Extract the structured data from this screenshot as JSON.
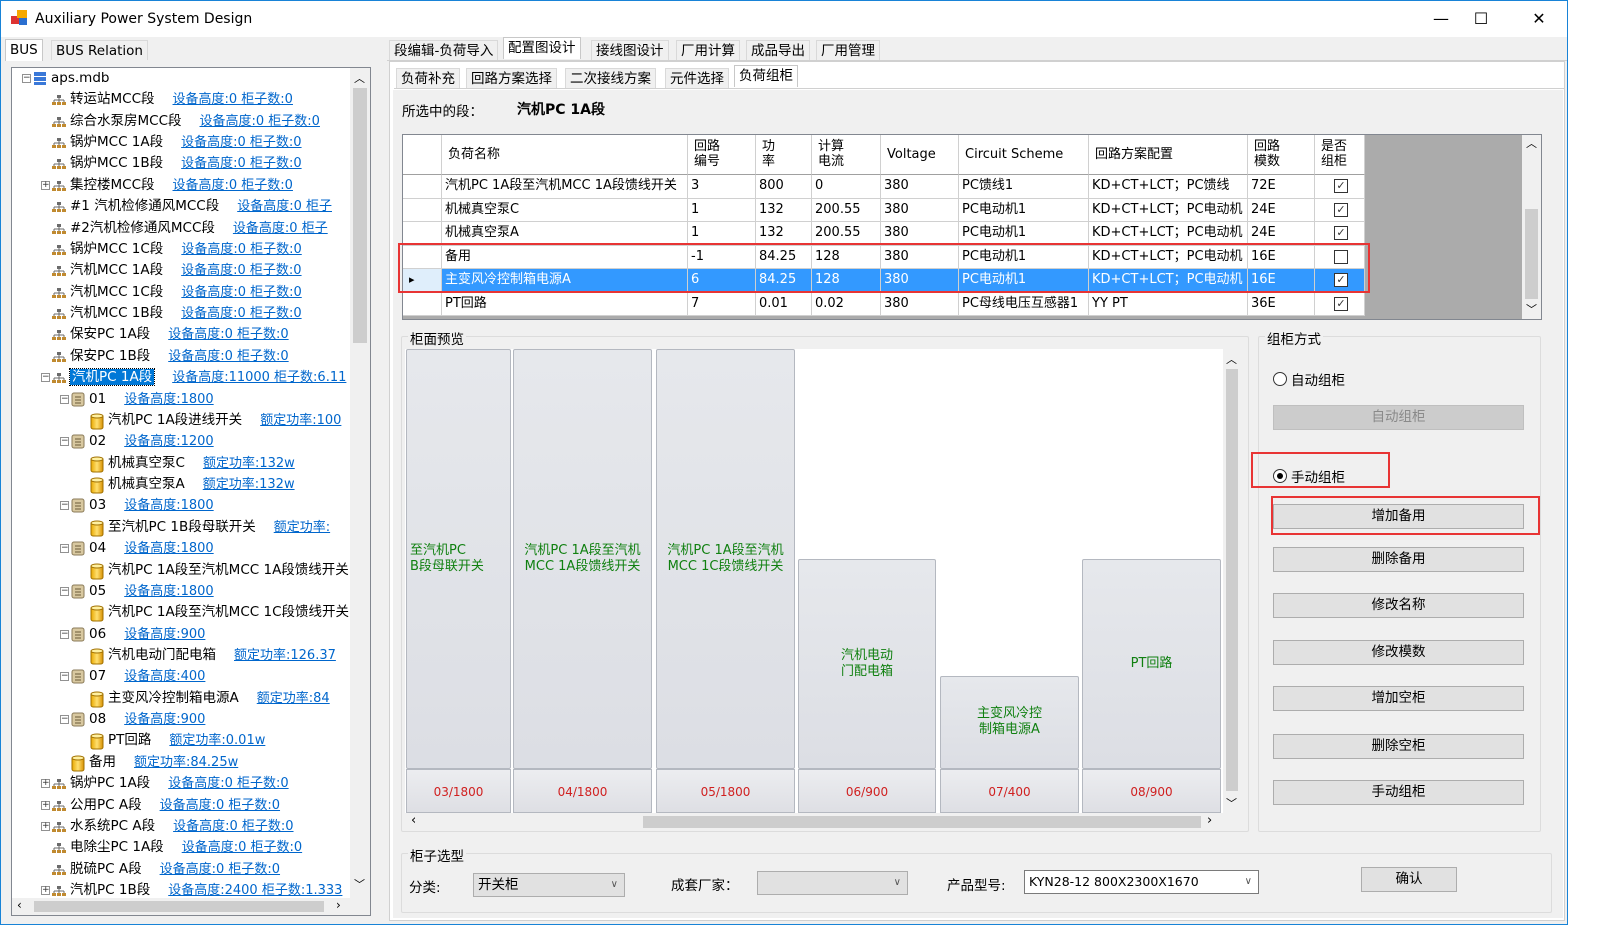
{
  "window": {
    "title": "Auxiliary Power System Design",
    "controls": [
      "—",
      "☐",
      "✕"
    ]
  },
  "left_tabs": [
    "BUS",
    "BUS Relation"
  ],
  "main_tabs": [
    "段编辑-负荷导入",
    "配置图设计",
    "接线图设计",
    "厂用计算",
    "成品导出",
    "厂用管理"
  ],
  "sub_tabs": [
    "负荷补充",
    "回路方案选择",
    "二次接线方案",
    "元件选择",
    "负荷组柜"
  ],
  "selected_segment": {
    "label": "所选中的段：",
    "value": "汽机PC 1A段"
  },
  "tree": [
    {
      "level": 0,
      "icon": "database-icon",
      "exp": "-",
      "label": "aps.mdb",
      "link": ""
    },
    {
      "level": 1,
      "icon": "network-icon",
      "exp": "",
      "label": "转运站MCC段",
      "link": "设备高度:0  柜子数:0"
    },
    {
      "level": 1,
      "icon": "network-icon",
      "exp": "",
      "label": "综合水泵房MCC段",
      "link": "设备高度:0  柜子数:0"
    },
    {
      "level": 1,
      "icon": "network-icon",
      "exp": "",
      "label": "锅炉MCC 1A段",
      "link": "设备高度:0  柜子数:0"
    },
    {
      "level": 1,
      "icon": "network-icon",
      "exp": "",
      "label": "锅炉MCC 1B段",
      "link": "设备高度:0  柜子数:0"
    },
    {
      "level": 1,
      "icon": "network-icon",
      "exp": "+",
      "label": "集控楼MCC段",
      "link": "设备高度:0  柜子数:0"
    },
    {
      "level": 1,
      "icon": "network-icon",
      "exp": "",
      "label": "#1 汽机检修通风MCC段",
      "link": "设备高度:0  柜子"
    },
    {
      "level": 1,
      "icon": "network-icon",
      "exp": "",
      "label": "#2汽机检修通风MCC段",
      "link": "设备高度:0  柜子"
    },
    {
      "level": 1,
      "icon": "network-icon",
      "exp": "",
      "label": "锅炉MCC 1C段",
      "link": "设备高度:0  柜子数:0"
    },
    {
      "level": 1,
      "icon": "network-icon",
      "exp": "",
      "label": "汽机MCC 1A段",
      "link": "设备高度:0  柜子数:0"
    },
    {
      "level": 1,
      "icon": "network-icon",
      "exp": "",
      "label": "汽机MCC 1C段",
      "link": "设备高度:0  柜子数:0"
    },
    {
      "level": 1,
      "icon": "network-icon",
      "exp": "",
      "label": "汽机MCC 1B段",
      "link": "设备高度:0  柜子数:0"
    },
    {
      "level": 1,
      "icon": "network-icon",
      "exp": "",
      "label": "保安PC 1A段",
      "link": "设备高度:0  柜子数:0"
    },
    {
      "level": 1,
      "icon": "network-icon",
      "exp": "",
      "label": "保安PC 1B段",
      "link": "设备高度:0  柜子数:0"
    },
    {
      "level": 1,
      "icon": "network-icon",
      "exp": "-",
      "label": "汽机PC 1A段",
      "link": "设备高度:11000  柜子数:6.11",
      "selected": true
    },
    {
      "level": 2,
      "icon": "cabinet-icon",
      "exp": "-",
      "label": "01",
      "link": "设备高度:1800"
    },
    {
      "level": 3,
      "icon": "cylinder-icon",
      "exp": "",
      "label": "汽机PC 1A段进线开关",
      "link": "额定功率:100"
    },
    {
      "level": 2,
      "icon": "cabinet-icon",
      "exp": "-",
      "label": "02",
      "link": "设备高度:1200"
    },
    {
      "level": 3,
      "icon": "cylinder-icon",
      "exp": "",
      "label": "机械真空泵C",
      "link": "额定功率:132w"
    },
    {
      "level": 3,
      "icon": "cylinder-icon",
      "exp": "",
      "label": "机械真空泵A",
      "link": "额定功率:132w"
    },
    {
      "level": 2,
      "icon": "cabinet-icon",
      "exp": "-",
      "label": "03",
      "link": "设备高度:1800"
    },
    {
      "level": 3,
      "icon": "cylinder-icon",
      "exp": "",
      "label": "至汽机PC 1B段母联开关",
      "link": "额定功率:"
    },
    {
      "level": 2,
      "icon": "cabinet-icon",
      "exp": "-",
      "label": "04",
      "link": "设备高度:1800"
    },
    {
      "level": 3,
      "icon": "cylinder-icon",
      "exp": "",
      "label": "汽机PC 1A段至汽机MCC 1A段馈线开关",
      "link": ""
    },
    {
      "level": 2,
      "icon": "cabinet-icon",
      "exp": "-",
      "label": "05",
      "link": "设备高度:1800"
    },
    {
      "level": 3,
      "icon": "cylinder-icon",
      "exp": "",
      "label": "汽机PC 1A段至汽机MCC 1C段馈线开关",
      "link": ""
    },
    {
      "level": 2,
      "icon": "cabinet-icon",
      "exp": "-",
      "label": "06",
      "link": "设备高度:900"
    },
    {
      "level": 3,
      "icon": "cylinder-icon",
      "exp": "",
      "label": "汽机电动门配电箱",
      "link": "额定功率:126.37"
    },
    {
      "level": 2,
      "icon": "cabinet-icon",
      "exp": "-",
      "label": "07",
      "link": "设备高度:400"
    },
    {
      "level": 3,
      "icon": "cylinder-icon",
      "exp": "",
      "label": "主变风冷控制箱电源A",
      "link": "额定功率:84"
    },
    {
      "level": 2,
      "icon": "cabinet-icon",
      "exp": "-",
      "label": "08",
      "link": "设备高度:900"
    },
    {
      "level": 3,
      "icon": "cylinder-icon",
      "exp": "",
      "label": "PT回路",
      "link": "额定功率:0.01w"
    },
    {
      "level": 2,
      "icon": "cylinder-icon",
      "exp": "",
      "label": "备用",
      "link": "额定功率:84.25w"
    },
    {
      "level": 1,
      "icon": "network-icon",
      "exp": "+",
      "label": "锅炉PC 1A段",
      "link": "设备高度:0  柜子数:0"
    },
    {
      "level": 1,
      "icon": "network-icon",
      "exp": "+",
      "label": "公用PC A段",
      "link": "设备高度:0  柜子数:0"
    },
    {
      "level": 1,
      "icon": "network-icon",
      "exp": "+",
      "label": "水系统PC A段",
      "link": "设备高度:0  柜子数:0"
    },
    {
      "level": 1,
      "icon": "network-icon",
      "exp": "",
      "label": "电除尘PC 1A段",
      "link": "设备高度:0  柜子数:0"
    },
    {
      "level": 1,
      "icon": "network-icon",
      "exp": "",
      "label": "脱硫PC A段",
      "link": "设备高度:0  柜子数:0"
    },
    {
      "level": 1,
      "icon": "network-icon",
      "exp": "+",
      "label": "汽机PC 1B段",
      "link": "设备高度:2400  柜子数:1.333"
    }
  ],
  "grid": {
    "columns": [
      "负荷名称",
      "回路\n编号",
      "功\n率",
      "计算\n电流",
      "Voltage",
      "Circuit Scheme",
      "回路方案配置",
      "回路\n模数",
      "是否\n组柜"
    ],
    "rows": [
      [
        "汽机PC 1A段至汽机MCC 1A段馈线开关",
        "3",
        "800",
        "0",
        "380",
        "PC馈线1",
        "KD+CT+LCT；PC馈线",
        "72E",
        true
      ],
      [
        "机械真空泵C",
        "1",
        "132",
        "200.55",
        "380",
        "PC电动机1",
        "KD+CT+LCT；PC电动机",
        "24E",
        true
      ],
      [
        "机械真空泵A",
        "1",
        "132",
        "200.55",
        "380",
        "PC电动机1",
        "KD+CT+LCT；PC电动机",
        "24E",
        true
      ],
      [
        "备用",
        "-1",
        "84.25",
        "128",
        "380",
        "PC电动机1",
        "KD+CT+LCT；PC电动机",
        "16E",
        false
      ],
      [
        "主变风冷控制箱电源A",
        "6",
        "84.25",
        "128",
        "380",
        "PC电动机1",
        "KD+CT+LCT；PC电动机",
        "16E",
        true
      ],
      [
        "PT回路",
        "7",
        "0.01",
        "0.02",
        "380",
        "PC母线电压互感器1",
        "YY PT",
        "36E",
        true
      ]
    ],
    "selected_row": 4
  },
  "preview": {
    "title": "柜面预览",
    "cabinets": [
      {
        "label": "至汽机PC\nB段母联开关",
        "footer": "03/1800",
        "height": 1800
      },
      {
        "label": "汽机PC 1A段至汽机\nMCC 1A段馈线开关",
        "footer": "04/1800",
        "height": 1800
      },
      {
        "label": "汽机PC 1A段至汽机\nMCC 1C段馈线开关",
        "footer": "05/1800",
        "height": 1800
      },
      {
        "label": "汽机电动\n门配电箱",
        "footer": "06/900",
        "height": 900
      },
      {
        "label": "主变风冷控\n制箱电源A",
        "footer": "07/400",
        "height": 400
      },
      {
        "label": "PT回路",
        "footer": "08/900",
        "height": 900
      }
    ]
  },
  "mode": {
    "title": "组柜方式",
    "auto_radio": "自动组柜",
    "auto_button": "自动组柜",
    "manual_radio": "手动组柜",
    "selected": "manual",
    "buttons": [
      "增加备用",
      "删除备用",
      "修改名称",
      "修改模数",
      "增加空柜",
      "删除空柜",
      "手动组柜"
    ]
  },
  "selection": {
    "title": "柜子选型",
    "category_label": "分类:",
    "category_value": "开关柜",
    "vendor_label": "成套厂家：",
    "vendor_value": "",
    "model_label": "产品型号:",
    "model_value": "KYN28-12 800X2300X1670",
    "confirm": "确认"
  },
  "colors": {
    "selection": "#3399ff",
    "link": "#0066cc",
    "highlight": "#e83434",
    "cabinet_text": "#108010",
    "footer_text": "#d02020"
  }
}
